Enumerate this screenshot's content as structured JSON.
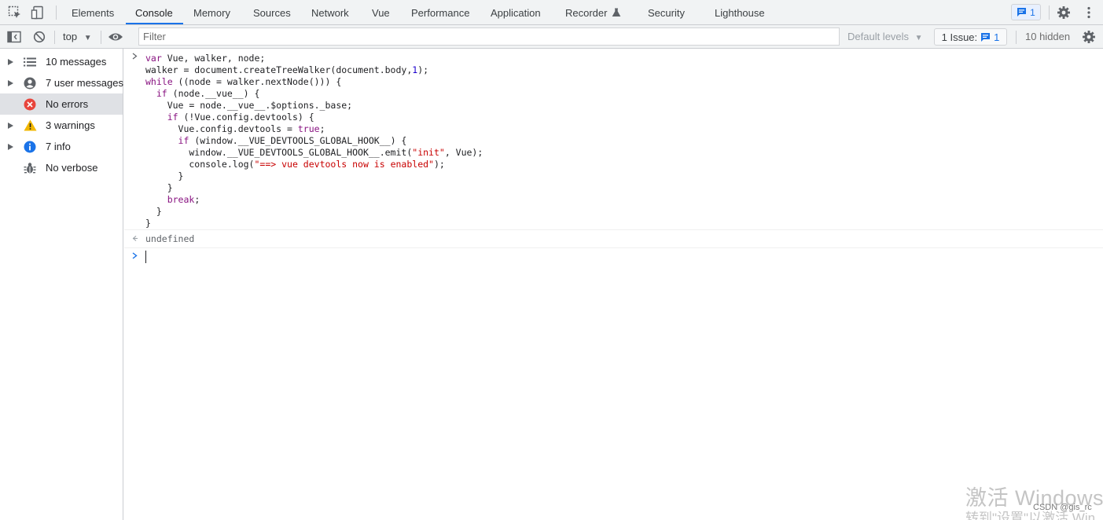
{
  "tabs": [
    "Elements",
    "Console",
    "Memory",
    "Sources",
    "Network",
    "Vue",
    "Performance",
    "Application",
    "Recorder",
    "Security",
    "Lighthouse"
  ],
  "active_tab": "Console",
  "message_badge": "1",
  "toolbar": {
    "context": "top",
    "filter_placeholder": "Filter",
    "levels": "Default levels",
    "issue_label": "1 Issue:",
    "issue_count": "1",
    "hidden": "10 hidden"
  },
  "sidebar": [
    {
      "label": "10 messages",
      "icon": "list-icon",
      "expandable": true
    },
    {
      "label": "7 user messages",
      "icon": "user-icon",
      "expandable": true
    },
    {
      "label": "No errors",
      "icon": "error-icon",
      "expandable": false,
      "selected": true
    },
    {
      "label": "3 warnings",
      "icon": "warning-icon",
      "expandable": true
    },
    {
      "label": "7 info",
      "icon": "info-icon",
      "expandable": true
    },
    {
      "label": "No verbose",
      "icon": "bug-icon",
      "expandable": false
    }
  ],
  "console": {
    "code_lines": [
      "var Vue, walker, node;",
      "walker = document.createTreeWalker(document.body,1);",
      "while ((node = walker.nextNode())) {",
      "  if (node.__vue__) {",
      "    Vue = node.__vue__.$options._base;",
      "    if (!Vue.config.devtools) {",
      "      Vue.config.devtools = true;",
      "      if (window.__VUE_DEVTOOLS_GLOBAL_HOOK__) {",
      "        window.__VUE_DEVTOOLS_GLOBAL_HOOK__.emit(\"init\", Vue);",
      "        console.log(\"==> vue devtools now is enabled\");",
      "      }",
      "    }",
      "    break;",
      "  }",
      "}"
    ],
    "result": "undefined"
  },
  "watermark": {
    "line1": "激活 Windows",
    "line2": "转到\"设置\"以激活 Win",
    "credit": "CSDN @gis_rc"
  },
  "colors": {
    "accent": "#1a73e8",
    "keyword": "#881280",
    "string": "#c80000",
    "number": "#1c00cf",
    "error": "#e8453c",
    "warning": "#f2b700"
  }
}
